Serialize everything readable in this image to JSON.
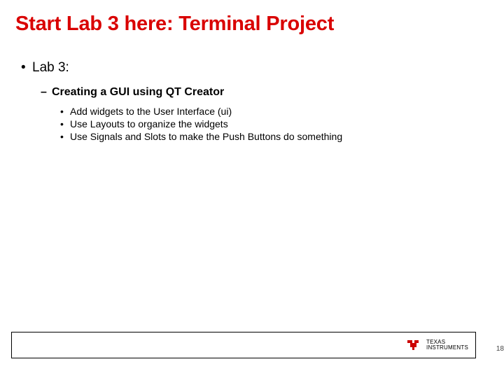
{
  "slide": {
    "title": "Start Lab 3 here: Terminal Project",
    "level1": {
      "text": "Lab 3:"
    },
    "level2": {
      "text": "Creating a GUI using QT Creator"
    },
    "level3": [
      {
        "text": "Add widgets to the User Interface (ui)"
      },
      {
        "text": "Use Layouts to organize the widgets"
      },
      {
        "text": "Use Signals and Slots to make the Push Buttons do something"
      }
    ]
  },
  "footer": {
    "logo_text_line1": "TEXAS",
    "logo_text_line2": "INSTRUMENTS",
    "page_fragment": "18"
  }
}
